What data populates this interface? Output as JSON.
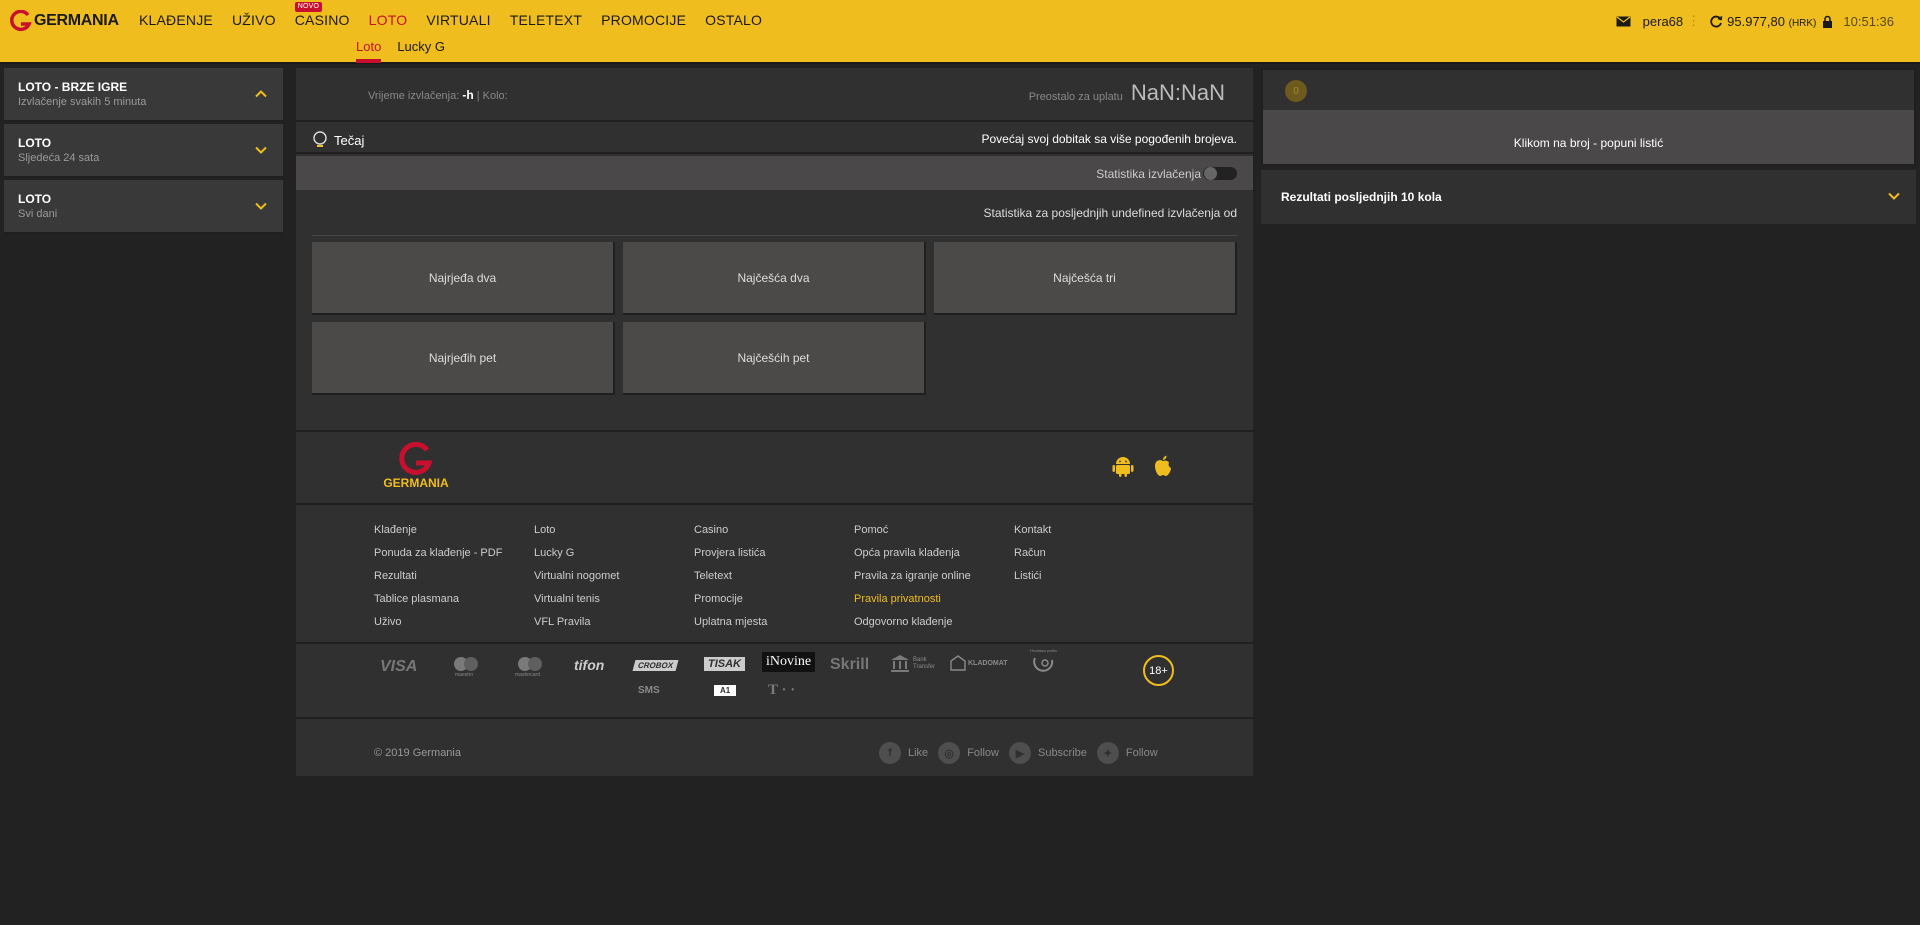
{
  "header": {
    "logo_text": "GERMANIA",
    "nav": [
      {
        "label": "KLAĐENJE",
        "active": false
      },
      {
        "label": "UŽIVO",
        "active": false
      },
      {
        "label": "CASINO",
        "active": false,
        "badge": "NOVO"
      },
      {
        "label": "LOTO",
        "active": true
      },
      {
        "label": "VIRTUALI",
        "active": false
      },
      {
        "label": "TELETEXT",
        "active": false
      },
      {
        "label": "PROMOCIJE",
        "active": false
      },
      {
        "label": "OSTALO",
        "active": false
      }
    ],
    "subnav": [
      {
        "label": "Loto",
        "active": true
      },
      {
        "label": "Lucky G",
        "active": false
      }
    ],
    "user": {
      "username": "pera68",
      "balance": "95.977,80",
      "currency": "(HRK)",
      "time": "10:51:36"
    },
    "colors": {
      "brand_yellow": "#f0bd1e",
      "brand_red": "#c8102e"
    }
  },
  "sidebar": {
    "items": [
      {
        "title": "LOTO - BRZE IGRE",
        "subtitle": "Izvlačenje svakih 5 minuta",
        "expanded": true
      },
      {
        "title": "LOTO",
        "subtitle": "Sljedeća 24 sata",
        "expanded": false
      },
      {
        "title": "LOTO",
        "subtitle": "Svi dani",
        "expanded": false
      }
    ]
  },
  "draw_info": {
    "time_label": "Vrijeme izvlačenja:",
    "time_value": "-h",
    "round_label": "| Kolo:",
    "remaining_label": "Preostalo za uplatu",
    "countdown": "NaN:NaN"
  },
  "odds": {
    "toggle_label": "Tečaj",
    "promo_message": "Povećaj svoj dobitak sa više pogođenih brojeva."
  },
  "statistics": {
    "toggle_label": "Statistika izvlačenja",
    "toggle_on": false,
    "caption": "Statistika za posljednjih undefined izvlačenja od",
    "boxes": [
      "Najrjeđa dva",
      "Najčešća dva",
      "Najčešća tri",
      "Najrjeđih pet",
      "Najčešćih pet"
    ]
  },
  "footer": {
    "logo_text": "GERMANIA",
    "apps": [
      "android-icon",
      "apple-icon"
    ],
    "columns": [
      [
        {
          "label": "Klađenje"
        },
        {
          "label": "Ponuda za klađenje - PDF"
        },
        {
          "label": "Rezultati"
        },
        {
          "label": "Tablice plasmana"
        },
        {
          "label": "Uživo"
        }
      ],
      [
        {
          "label": "Loto"
        },
        {
          "label": "Lucky G"
        },
        {
          "label": "Virtualni nogomet"
        },
        {
          "label": "Virtualni tenis"
        },
        {
          "label": "VFL Pravila"
        }
      ],
      [
        {
          "label": "Casino"
        },
        {
          "label": "Provjera listića"
        },
        {
          "label": "Teletext"
        },
        {
          "label": "Promocije"
        },
        {
          "label": "Uplatna mjesta"
        }
      ],
      [
        {
          "label": "Pomoć"
        },
        {
          "label": "Opća pravila klađenja"
        },
        {
          "label": "Pravila za igranje online"
        },
        {
          "label": "Pravila privatnosti",
          "highlight": true
        },
        {
          "label": "Odgovorno klađenje"
        }
      ],
      [
        {
          "label": "Kontakt"
        },
        {
          "label": "Račun"
        },
        {
          "label": "Listići"
        }
      ]
    ],
    "payments": [
      "VISA",
      "maestro",
      "mastercard",
      "tifon",
      "CROBOX",
      "TISAK",
      "iNovine",
      "Skrill",
      "Bank Transfer",
      "KLADOMAT",
      "Hrvatska pošta",
      "SMS",
      "A1",
      "T · ·"
    ],
    "age_badge": "18+",
    "copyright": "© 2019 Germania",
    "socials": [
      {
        "icon": "facebook-icon",
        "label": "Like"
      },
      {
        "icon": "instagram-icon",
        "label": "Follow"
      },
      {
        "icon": "youtube-icon",
        "label": "Subscribe"
      },
      {
        "icon": "twitter-icon",
        "label": "Follow"
      }
    ]
  },
  "ticket": {
    "count": "0",
    "message": "Klikom na broj - popuni listić"
  },
  "results": {
    "label": "Rezultati posljednjih 10 kola"
  }
}
